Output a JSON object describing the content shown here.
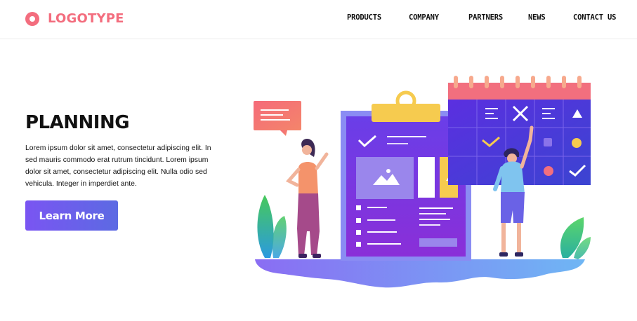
{
  "header": {
    "logo_text": "LOGOTYPE",
    "nav": [
      "PRODUCTS",
      "COMPANY",
      "PARTNERS",
      "NEWS",
      "CONTACT US"
    ]
  },
  "hero": {
    "title": "PLANNING",
    "body": "Lorem ipsum dolor sit amet, consectetur adipiscing elit. In sed mauris commodo erat rutrum tincidunt. Lorem ipsum dolor sit amet, consectetur adipiscing elit. Nulla  odio sed vehicula. Integer in imperdiet ante.",
    "cta_label": "Learn More"
  },
  "colors": {
    "brand": "#f36d7e",
    "button_start": "#7a55f2",
    "button_end": "#5c6ae3",
    "calendar_header": "#f26f7e",
    "calendar_body": "#4d2fd6",
    "clipboard_clip": "#f6cb4f"
  },
  "illustration": {
    "icons": [
      "speech-bubble-icon",
      "clipboard-icon",
      "calendar-icon",
      "checkmark-icon",
      "cross-icon",
      "triangle-icon",
      "circle-icon",
      "image-placeholder-icon",
      "leaf-plant-icon"
    ]
  }
}
